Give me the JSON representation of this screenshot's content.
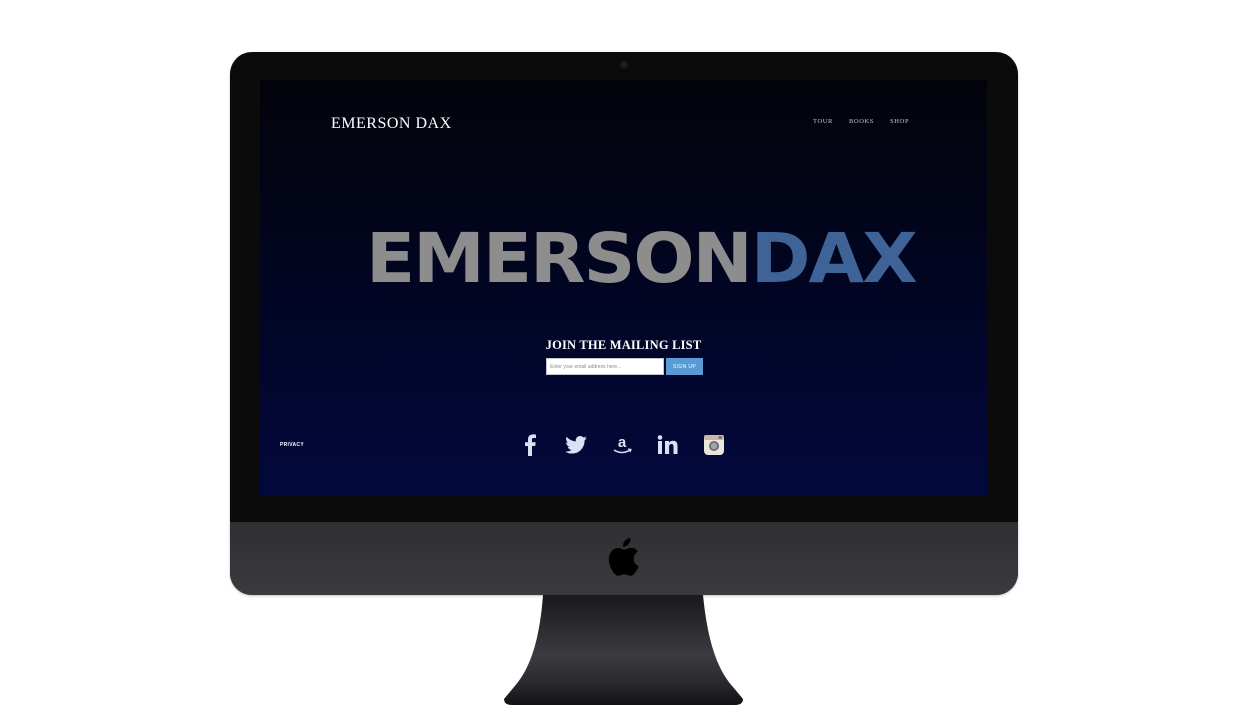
{
  "site": {
    "logo": "EMERSON DAX",
    "nav": [
      "TOUR",
      "BOOKS",
      "SHOP"
    ],
    "hero": {
      "first": "EMERSON",
      "second": "DAX"
    },
    "mailing": {
      "title": "JOIN THE MAILING LIST",
      "placeholder": "Enter your email address here...",
      "button": "SIGN UP"
    },
    "footer": {
      "privacy": "PRIVACY",
      "social_icons": [
        "facebook-icon",
        "twitter-icon",
        "amazon-icon",
        "linkedin-icon",
        "instagram-icon"
      ]
    }
  },
  "colors": {
    "hero_first": "#8d8d8e",
    "hero_second": "#3f6396",
    "button": "#5b9bd5",
    "icon": "#d8e2f2",
    "background_top": "#02030a",
    "background_bottom": "#03083d"
  }
}
